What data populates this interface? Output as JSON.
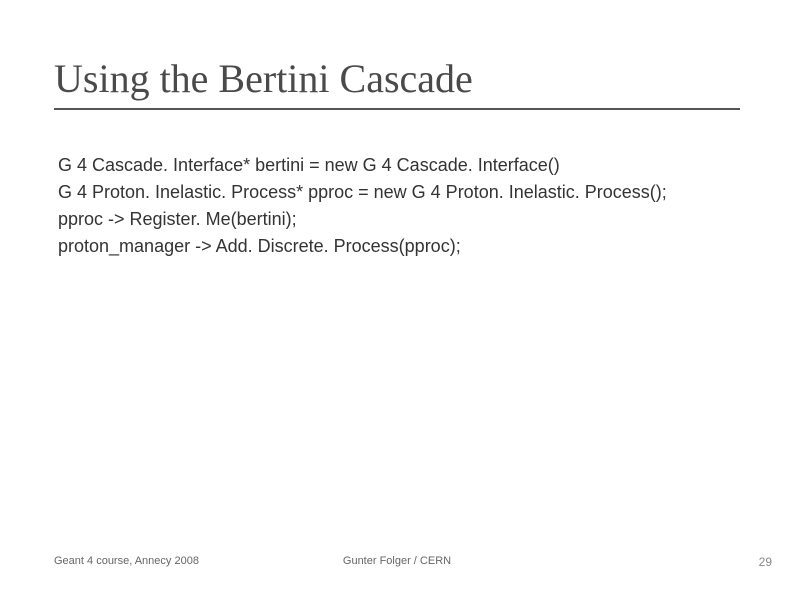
{
  "title": "Using the Bertini Cascade",
  "code": {
    "line1": "G 4 Cascade. Interface* bertini = new G 4 Cascade. Interface()",
    "line2": "G 4 Proton. Inelastic. Process* pproc = new G 4 Proton. Inelastic. Process();",
    "line3": "pproc -> Register. Me(bertini);",
    "line4": "proton_manager -> Add. Discrete. Process(pproc);"
  },
  "footer": {
    "left": "Geant 4 course, Annecy 2008",
    "center": "Gunter Folger / CERN",
    "right": "29"
  }
}
